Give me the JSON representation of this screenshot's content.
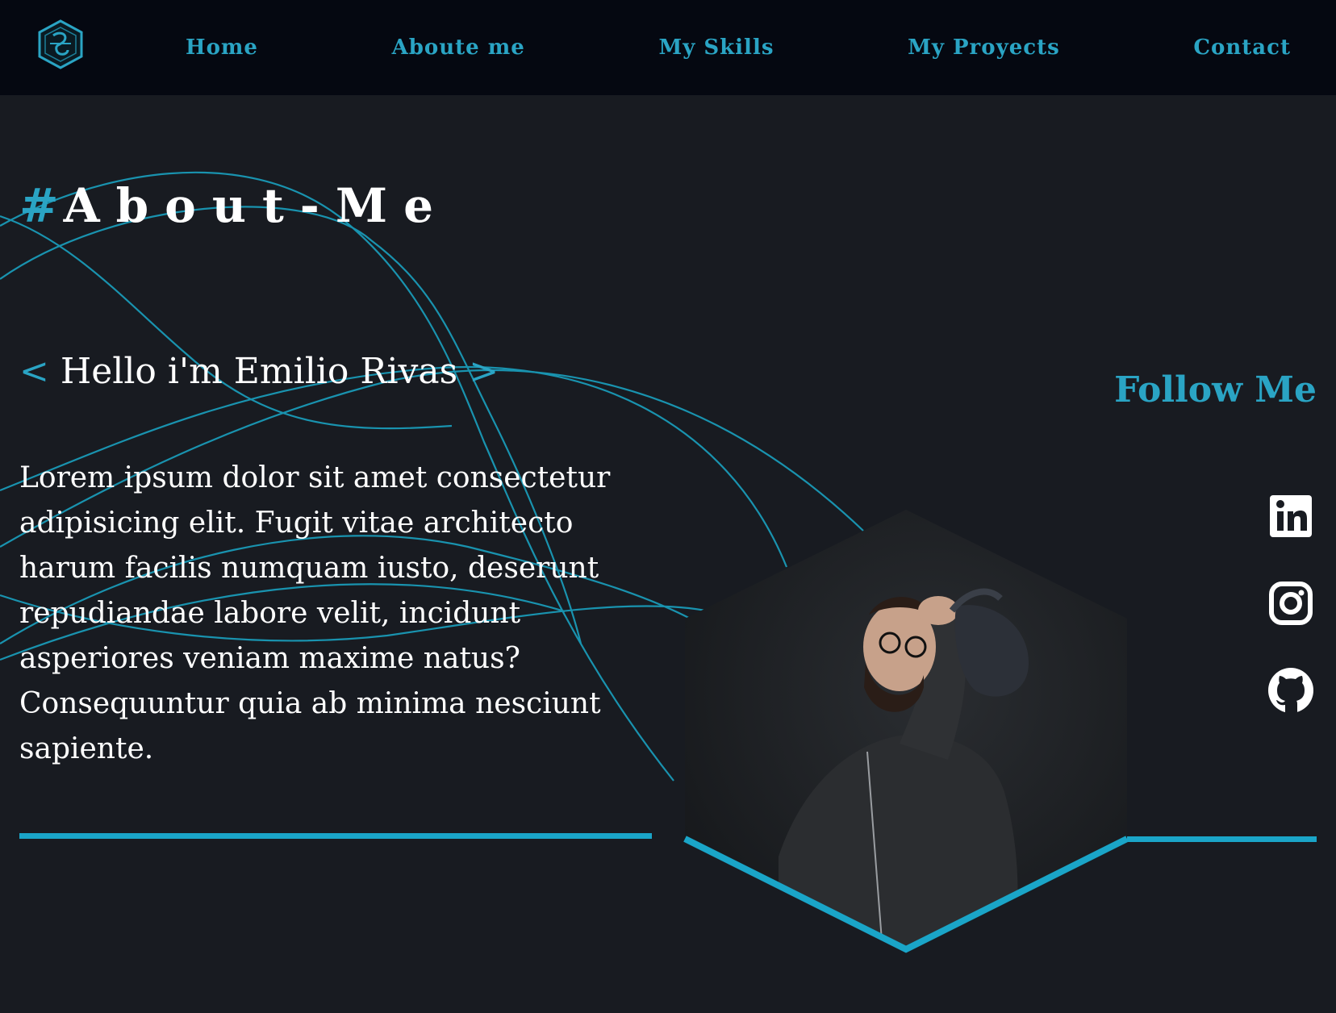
{
  "nav": {
    "logo_icon": "hexagon-monogram-logo-icon",
    "links": [
      "Home",
      "Aboute me",
      "My Skills",
      "My Proyects",
      "Contact"
    ]
  },
  "about": {
    "hash": "#",
    "title": "About-Me",
    "hello_open": "<",
    "hello_text": "Hello i'm Emilio Rivas",
    "hello_close": ">",
    "bio": "Lorem ipsum dolor sit amet consectetur adipisicing elit. Fugit vitae architecto harum facilis numquam iusto, deserunt repudiandae labore velit, incidunt asperiores veniam maxime natus? Consequuntur quia ab minima nesciunt sapiente."
  },
  "photo": {
    "subject": "man-looking-up-holding-cap-photo"
  },
  "follow": {
    "title": "Follow Me",
    "icons": [
      "linkedin-icon",
      "instagram-icon",
      "github-icon"
    ]
  },
  "colors": {
    "accent": "#2aa4c4",
    "background": "#181b21",
    "nav_background": "#050811",
    "text": "#ffffff"
  }
}
